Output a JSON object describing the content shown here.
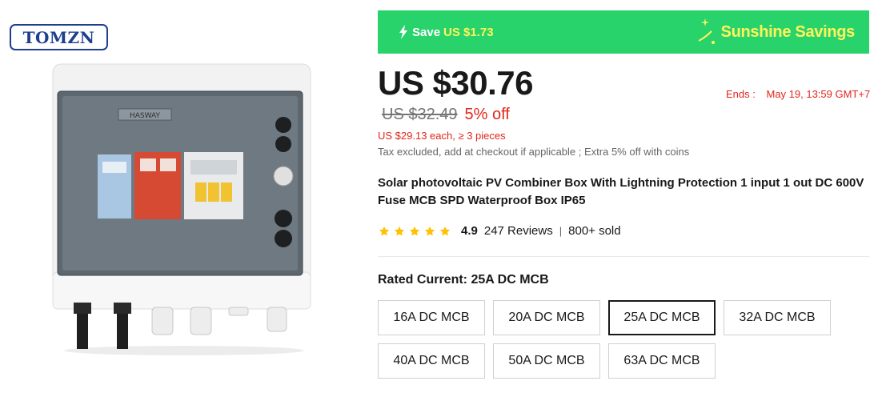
{
  "brand": {
    "logo_text": "TOMZN"
  },
  "promo": {
    "save_label": "Save",
    "save_amount": "US $1.73",
    "campaign": "Sunshine Savings",
    "colors": {
      "banner": "#28d36b",
      "highlight": "#fff45c"
    }
  },
  "price": {
    "current": "US $30.76",
    "original": "US $32.49",
    "discount": "5% off",
    "bulk": "US $29.13 each, ≥ 3 pieces",
    "tax_note": "Tax excluded, add at checkout if applicable ; Extra 5% off with coins",
    "ends_label": "Ends :",
    "ends_time": "May 19, 13:59 GMT+7"
  },
  "product": {
    "title": "Solar photovoltaic PV Combiner Box With Lightning Protection 1 input 1 out DC 600V Fuse MCB SPD Waterproof Box IP65",
    "image_label": "HASWAY"
  },
  "rating": {
    "value": "4.9",
    "stars": 5,
    "reviews": "247 Reviews",
    "separator": "|",
    "sold": "800+ sold"
  },
  "variant": {
    "label": "Rated Current: 25A DC MCB",
    "selected": "25A DC MCB",
    "options": [
      "16A DC MCB",
      "20A DC MCB",
      "25A DC MCB",
      "32A DC MCB",
      "40A DC MCB",
      "50A DC MCB",
      "63A DC MCB"
    ]
  }
}
